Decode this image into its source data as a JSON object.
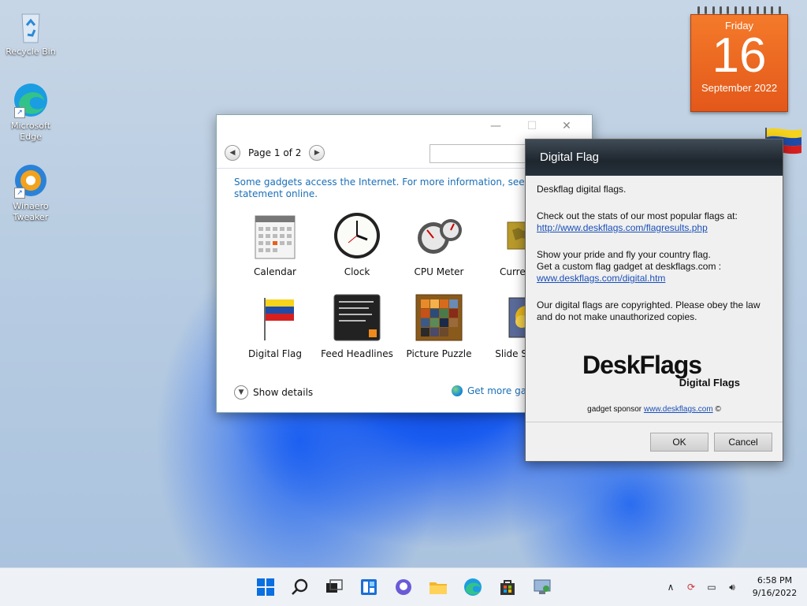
{
  "desktop": {
    "icons": [
      {
        "label": "Recycle Bin",
        "icon": "recycle-bin-icon"
      },
      {
        "label": "Microsoft Edge",
        "icon": "edge-icon"
      },
      {
        "label": "Winaero Tweaker",
        "icon": "winaero-tweaker-icon"
      }
    ]
  },
  "calendar_widget": {
    "day_of_week": "Friday",
    "day": "16",
    "month_year": "September 2022"
  },
  "gallery": {
    "page_label": "Page 1 of 2",
    "search_placeholder": "",
    "notice": "Some gadgets access the Internet.  For more information, see the privacy statement online.",
    "gadgets": [
      {
        "label": "Calendar",
        "icon": "calendar-icon"
      },
      {
        "label": "Clock",
        "icon": "clock-icon"
      },
      {
        "label": "CPU Meter",
        "icon": "cpu-meter-icon"
      },
      {
        "label": "Currency",
        "icon": "currency-icon"
      },
      {
        "label": "Digital Flag",
        "icon": "flag-icon"
      },
      {
        "label": "Feed Headlines",
        "icon": "feed-icon"
      },
      {
        "label": "Picture Puzzle",
        "icon": "puzzle-icon"
      },
      {
        "label": "Slide Show",
        "icon": "slideshow-icon"
      }
    ],
    "show_details": "Show details",
    "get_more": "Get more gadgets online"
  },
  "flag_dialog": {
    "title": "Digital Flag",
    "intro": "Deskflag digital flags.",
    "stats_text": "Check out the stats of our most popular flags at:",
    "stats_link": "http://www.deskflags.com/flagresults.php",
    "pride_line1": "Show your pride and fly your country flag.",
    "pride_line2": "Get a custom flag gadget at deskflags.com :",
    "digital_link": "www.deskflags.com/digital.htm",
    "copyright_text": "Our digital flags are copyrighted. Please obey the law and do not make unauthorized copies.",
    "logo_big": "DeskFlags",
    "logo_small": "Digital Flags",
    "sponsor_prefix": "gadget sponsor",
    "sponsor_link": "www.deskflags.com",
    "sponsor_suffix": "©",
    "ok_label": "OK",
    "cancel_label": "Cancel"
  },
  "taskbar": {
    "apps": [
      "start-icon",
      "search-icon",
      "task-view-icon",
      "widgets-icon",
      "chat-icon",
      "file-explorer-icon",
      "edge-icon",
      "store-icon",
      "control-panel-icon"
    ],
    "time": "6:58 PM",
    "date": "9/16/2022"
  },
  "colors": {
    "accent": "#1a6fb8",
    "calendar_orange": "#e8601c"
  }
}
